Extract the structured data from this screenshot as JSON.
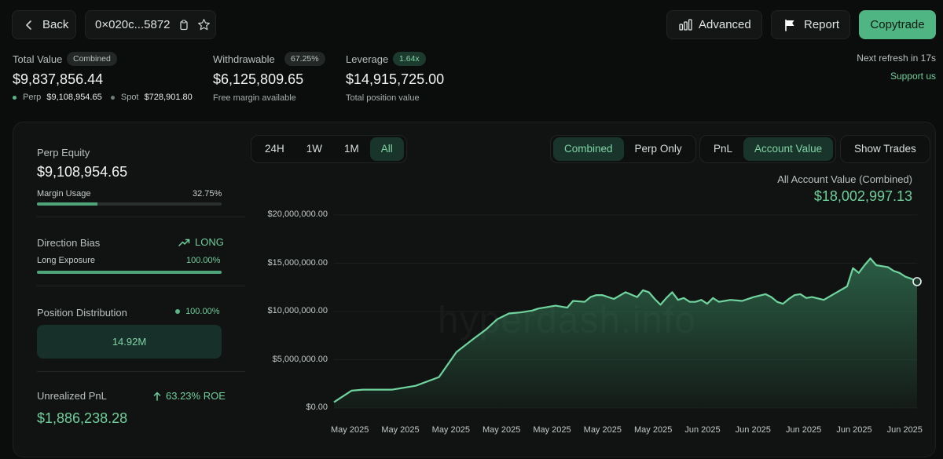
{
  "header": {
    "back_label": "Back",
    "address": "0×020c...5872",
    "advanced_label": "Advanced",
    "report_label": "Report",
    "copytrade_label": "Copytrade",
    "next_refresh": "Next refresh in 17s",
    "support_label": "Support us"
  },
  "summary": {
    "total_value_label": "Total Value",
    "total_value_badge": "Combined",
    "total_value": "$9,837,856.44",
    "perp_label": "Perp",
    "perp_value": "$9,108,954.65",
    "spot_label": "Spot",
    "spot_value": "$728,901.80",
    "withdrawable_label": "Withdrawable",
    "withdrawable_badge": "67.25%",
    "withdrawable_value": "$6,125,809.65",
    "withdrawable_sub": "Free margin available",
    "leverage_label": "Leverage",
    "leverage_badge": "1.64x",
    "leverage_value": "$14,915,725.00",
    "leverage_sub": "Total position value"
  },
  "sidebar": {
    "perp_equity_label": "Perp Equity",
    "perp_equity_value": "$9,108,954.65",
    "margin_usage_label": "Margin Usage",
    "margin_usage_value": "32.75%",
    "margin_usage_fraction": 0.3275,
    "direction_label": "Direction Bias",
    "direction_value": "LONG",
    "long_exposure_label": "Long Exposure",
    "long_exposure_value": "100.00%",
    "long_exposure_fraction": 1.0,
    "position_dist_label": "Position Distribution",
    "position_dist_value": "100.00%",
    "position_dist_box": "14.92M",
    "unrealized_label": "Unrealized PnL",
    "unrealized_roe": "63.23% ROE",
    "unrealized_value": "$1,886,238.28"
  },
  "controls": {
    "ranges": [
      "24H",
      "1W",
      "1M",
      "All"
    ],
    "active_range": "All",
    "modes": [
      "Combined",
      "Perp Only"
    ],
    "active_mode": "Combined",
    "metrics": [
      "PnL",
      "Account Value"
    ],
    "active_metric": "Account Value",
    "show_trades_label": "Show Trades"
  },
  "watermark": "hyperdash.info",
  "colors": {
    "accent": "#6fcf9c",
    "copytrade_bg": "#4fb583",
    "line": "#6fd49e"
  },
  "chart_data": {
    "type": "area",
    "title": "All Account Value (Combined)",
    "current_value": "$18,002,997.13",
    "ylim": [
      0,
      20000000
    ],
    "y_ticks": [
      "$0.00",
      "$5,000,000.00",
      "$10,000,000.00",
      "$15,000,000.00",
      "$20,000,000.00"
    ],
    "x_ticks": [
      "May 2025",
      "May 2025",
      "May 2025",
      "May 2025",
      "May 2025",
      "May 2025",
      "May 2025",
      "Jun 2025",
      "Jun 2025",
      "Jun 2025",
      "Jun 2025",
      "Jun 2025"
    ],
    "x_range": [
      0,
      100
    ],
    "x": [
      0,
      1,
      3,
      5,
      8,
      10,
      14,
      18,
      21,
      24,
      26,
      28,
      30,
      32,
      34,
      35,
      37,
      38,
      40,
      41,
      43,
      44,
      45,
      46,
      48,
      50,
      52,
      53,
      54,
      55,
      56,
      57,
      58,
      59,
      60,
      61,
      62,
      63,
      64,
      65,
      66,
      67,
      68,
      70,
      72,
      74,
      75,
      76,
      77,
      78,
      79,
      80,
      81,
      82,
      84,
      86,
      88,
      89,
      90,
      91,
      92,
      93,
      95,
      96,
      97,
      98,
      99,
      100
    ],
    "values": [
      600000,
      1000000,
      1800000,
      1900000,
      1900000,
      1900000,
      2300000,
      3200000,
      5800000,
      7200000,
      8100000,
      9200000,
      9800000,
      9900000,
      10100000,
      10300000,
      10500000,
      10600000,
      10400000,
      11100000,
      11000000,
      11500000,
      11700000,
      11700000,
      11300000,
      12000000,
      11500000,
      12200000,
      12000000,
      11300000,
      10700000,
      11400000,
      12000000,
      11200000,
      11400000,
      11000000,
      11000000,
      11200000,
      10800000,
      11400000,
      11000000,
      11100000,
      11200000,
      11100000,
      11500000,
      11800000,
      11500000,
      11000000,
      10800000,
      11300000,
      11700000,
      11800000,
      11400000,
      11500000,
      11200000,
      11900000,
      12600000,
      14500000,
      14000000,
      14800000,
      15500000,
      14800000,
      14600000,
      14200000,
      14000000,
      13600000,
      13400000,
      13100000
    ]
  }
}
